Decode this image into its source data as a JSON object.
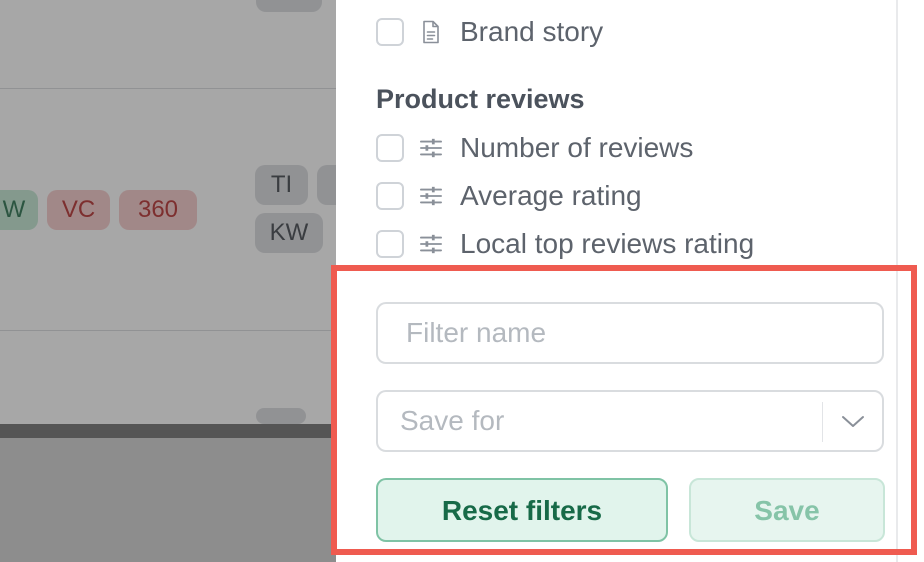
{
  "background": {
    "chips_row1": [
      {
        "text": "W",
        "tone": "green"
      },
      {
        "text": "VC",
        "tone": "red"
      },
      {
        "text": "360",
        "tone": "red"
      }
    ],
    "chips_right": [
      {
        "text": "TI"
      },
      {
        "text": "KW"
      }
    ]
  },
  "drawer": {
    "items_top": [
      {
        "label": "Brand story",
        "icon": "document-icon"
      }
    ],
    "section_title": "Product reviews",
    "review_items": [
      {
        "label": "Number of reviews",
        "icon": "sliders-icon"
      },
      {
        "label": "Average rating",
        "icon": "sliders-icon"
      },
      {
        "label": "Local top reviews rating",
        "icon": "sliders-icon"
      }
    ]
  },
  "footer": {
    "filter_name_placeholder": "Filter name",
    "save_for_placeholder": "Save for",
    "reset_label": "Reset filters",
    "save_label": "Save"
  },
  "colors": {
    "accent_green": "#176a48",
    "highlight": "#ef5b50"
  }
}
